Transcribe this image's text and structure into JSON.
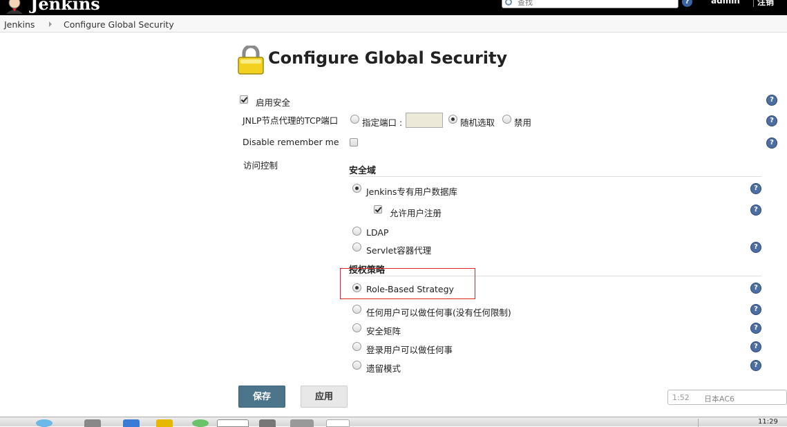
{
  "header": {
    "logo_text": "Jenkins",
    "search_placeholder": "查找",
    "user": "admin",
    "logout": "注销"
  },
  "breadcrumb": [
    "Jenkins",
    "Configure Global Security"
  ],
  "title": "Configure Global Security",
  "form": {
    "enable_security": {
      "label": "启用安全",
      "checked": true
    },
    "jnlp": {
      "label": "JNLP节点代理的TCP端口",
      "options": [
        {
          "label": "指定端口 :",
          "selected": false
        },
        {
          "label": "随机选取",
          "selected": true
        },
        {
          "label": "禁用",
          "selected": false
        }
      ],
      "port_value": ""
    },
    "disable_remember_me": {
      "label": "Disable remember me",
      "checked": false
    },
    "access_control": {
      "label": "访问控制"
    },
    "security_realm": {
      "title": "安全域",
      "options": [
        {
          "label": "Jenkins专有用户数据库",
          "selected": true
        },
        {
          "label": "LDAP",
          "selected": false
        },
        {
          "label": "Servlet容器代理",
          "selected": false
        }
      ],
      "allow_signup": {
        "label": "允许用户注册",
        "checked": true
      }
    },
    "authorization": {
      "title": "授权策略",
      "options": [
        {
          "label": "Role-Based Strategy",
          "selected": true
        },
        {
          "label": "任何用户可以做任何事(没有任何限制)",
          "selected": false
        },
        {
          "label": "安全矩阵",
          "selected": false
        },
        {
          "label": "登录用户可以做任何事",
          "selected": false
        },
        {
          "label": "遗留模式",
          "selected": false
        }
      ]
    }
  },
  "buttons": {
    "save": "保存",
    "apply": "应用"
  },
  "help_symbol": "?",
  "ime": {
    "left": "1:52",
    "right": "日本AC6"
  },
  "taskbar": {
    "clock": "11:29"
  },
  "colors": {
    "header_bg": "#000000",
    "save_button_bg": "#4b758b",
    "highlight_box": "#dd2222",
    "help_icon": "#4d6ea0"
  }
}
